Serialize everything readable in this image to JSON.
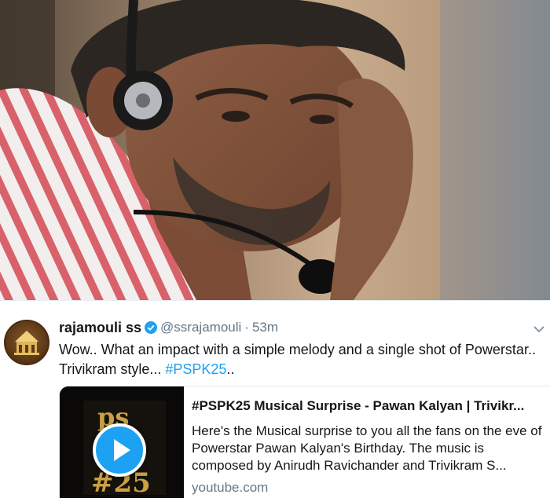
{
  "colors": {
    "link": "#1da1f2",
    "secondary_text": "#657786",
    "primary_text": "#14171a",
    "border": "#e1e8ed"
  },
  "tweet": {
    "author_name": "rajamouli ss",
    "handle": "@ssrajamouli",
    "separator": "·",
    "time": "53m",
    "text_before_hashtag": "Wow.. What an impact with a simple melody and a single shot of Powerstar.. Trivikram style... ",
    "hashtag": "#PSPK25",
    "text_after_hashtag": "..",
    "icons": {
      "avatar": "rajamouli-avatar",
      "verified": "verified-badge-icon",
      "menu": "chevron-down-icon"
    }
  },
  "card": {
    "title": "#PSPK25 Musical Surprise - Pawan Kalyan | Trivikr...",
    "description": "Here's the Musical surprise to you all the fans on the eve of Powerstar Pawan Kalyan's Birthday. The music is composed by Anirudh Ravichander and Trivikram S...",
    "domain": "youtube.com",
    "thumbnail_logo": "pspk-25-logo",
    "play_icon": "play-icon"
  }
}
